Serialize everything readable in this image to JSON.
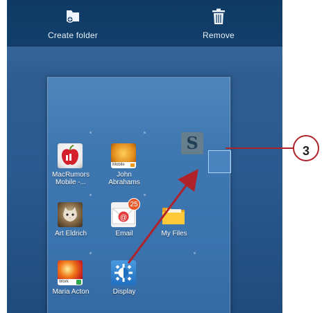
{
  "top_actions": {
    "create_folder_label": "Create folder",
    "remove_label": "Remove"
  },
  "apps": [
    {
      "label": "MacRumors\nMobile -...",
      "icon": "macrumors-apple-icon"
    },
    {
      "label": "John\nAbrahams",
      "icon": "contact-photo-icon",
      "badge_text": "Mobile"
    },
    {
      "label": "Art Eldrich",
      "icon": "contact-cat-photo-icon"
    },
    {
      "label": "Email",
      "icon": "email-icon",
      "badge": "25"
    },
    {
      "label": "My Files",
      "icon": "folder-icon"
    },
    {
      "label": "Maria Acton",
      "icon": "contact-photo-icon",
      "badge_text": "Work"
    },
    {
      "label": "Display",
      "icon": "display-settings-icon"
    }
  ],
  "dragged_tile_letter": "S",
  "callout_number": "3",
  "colors": {
    "callout": "#b0222a",
    "drop_target": "#a8d4ff"
  }
}
